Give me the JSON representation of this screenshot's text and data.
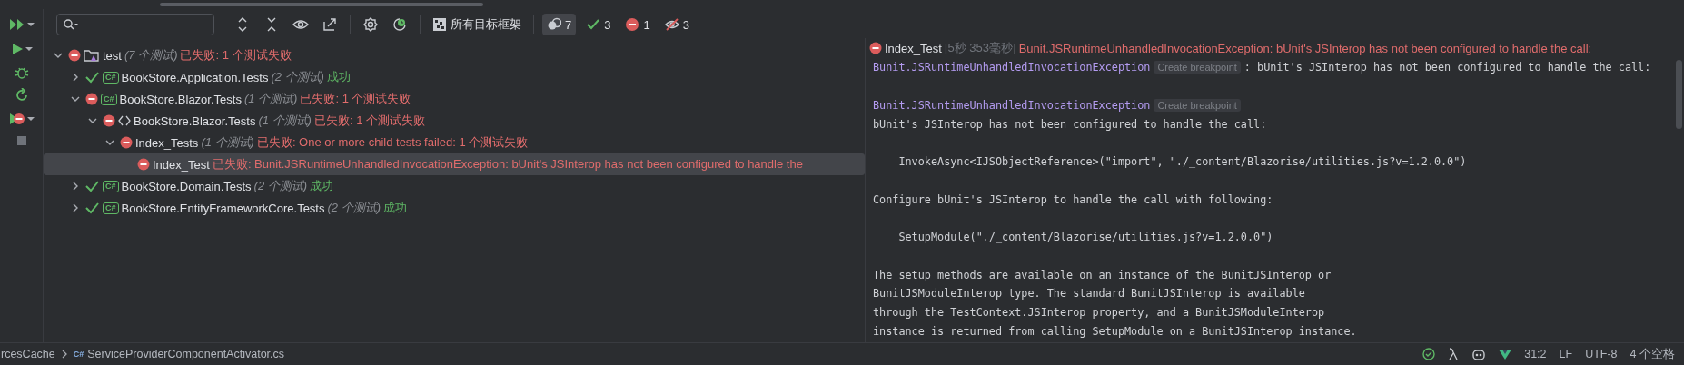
{
  "toolbar": {
    "target_frameworks": "所有目标框架",
    "counters": [
      {
        "kind": "total",
        "count": "7",
        "selected": true
      },
      {
        "kind": "passed",
        "count": "3",
        "selected": false
      },
      {
        "kind": "failed",
        "count": "1",
        "selected": false
      },
      {
        "kind": "ignored",
        "count": "3",
        "selected": false
      }
    ]
  },
  "tree": [
    {
      "kind": "root",
      "name": "test",
      "count": "(7 个测试)",
      "passed": false,
      "message": "已失败: 1 个测试失败",
      "expanded": true,
      "selected": false,
      "children": [
        {
          "kind": "project",
          "badge": "C#",
          "name": "BookStore.Application.Tests",
          "count": "(2 个测试)",
          "passed": true,
          "message": "成功",
          "expanded": false,
          "selected": false
        },
        {
          "kind": "project",
          "badge": "C#",
          "name": "BookStore.Blazor.Tests",
          "count": "(1 个测试)",
          "passed": false,
          "message": "已失败: 1 个测试失败",
          "expanded": true,
          "selected": false,
          "children": [
            {
              "kind": "namespace",
              "name": "BookStore.Blazor.Tests",
              "count": "(1 个测试)",
              "passed": false,
              "message": "已失败: 1 个测试失败",
              "expanded": true,
              "selected": false,
              "children": [
                {
                  "name": "Index_Tests",
                  "count": "(1 个测试)",
                  "passed": false,
                  "message": "已失败: One or more child tests failed: 1 个测试失败",
                  "expanded": true,
                  "selected": false,
                  "children": [
                    {
                      "name": "Index_Test",
                      "passed": false,
                      "message": "已失败: Bunit.JSRuntimeUnhandledInvocationException: bUnit's JSInterop has not been configured to handle the",
                      "selected": true
                    }
                  ]
                }
              ]
            }
          ]
        },
        {
          "kind": "project",
          "badge": "C#",
          "name": "BookStore.Domain.Tests",
          "count": "(2 个测试)",
          "passed": true,
          "message": "成功",
          "expanded": false,
          "selected": false
        },
        {
          "kind": "project",
          "badge": "C#",
          "name": "BookStore.EntityFrameworkCore.Tests",
          "count": "(2 个测试)",
          "passed": true,
          "message": "成功",
          "expanded": false,
          "selected": false
        }
      ]
    }
  ],
  "details": {
    "title": "Index_Test",
    "duration": "[5秒 353毫秒]",
    "passed": false,
    "message": "Bunit.JSRuntimeUnhandledInvocationException: bUnit's JSInterop has not been configured to handle the call:",
    "lines": [
      {
        "kind": "exception",
        "name": "Bunit.JSRuntimeUnhandledInvocationException",
        "badge": "Create breakpoint",
        "text": ": bUnit's JSInterop has not been configured to handle the call:"
      },
      {
        "kind": "blank"
      },
      {
        "kind": "exception",
        "name": "Bunit.JSRuntimeUnhandledInvocationException",
        "badge": "Create breakpoint"
      },
      {
        "kind": "text",
        "text": "bUnit's JSInterop has not been configured to handle the call:"
      },
      {
        "kind": "blank"
      },
      {
        "kind": "text",
        "text": "    InvokeAsync<IJSObjectReference>(\"import\", \"./_content/Blazorise/utilities.js?v=1.2.0.0\")"
      },
      {
        "kind": "blank"
      },
      {
        "kind": "text",
        "text": "Configure bUnit's JSInterop to handle the call with following:"
      },
      {
        "kind": "blank"
      },
      {
        "kind": "text",
        "text": "    SetupModule(\"./_content/Blazorise/utilities.js?v=1.2.0.0\")"
      },
      {
        "kind": "blank"
      },
      {
        "kind": "text",
        "text": "The setup methods are available on an instance of the BunitJSInterop or"
      },
      {
        "kind": "text",
        "text": "BunitJSModuleInterop type. The standard BunitJSInterop is available"
      },
      {
        "kind": "text",
        "text": "through the TestContext.JSInterop property, and a BunitJSModuleInterop"
      },
      {
        "kind": "text",
        "text": "instance is returned from calling SetupModule on a BunitJSInterop instance."
      }
    ]
  },
  "status_bar": {
    "breadcrumbs": [
      {
        "text": "rcesCache"
      },
      {
        "badge": "C#",
        "text": "ServiceProviderComponentActivator.cs"
      }
    ],
    "position": "31:2",
    "line_ending": "LF",
    "encoding": "UTF-8",
    "indent": "4 个空格"
  }
}
